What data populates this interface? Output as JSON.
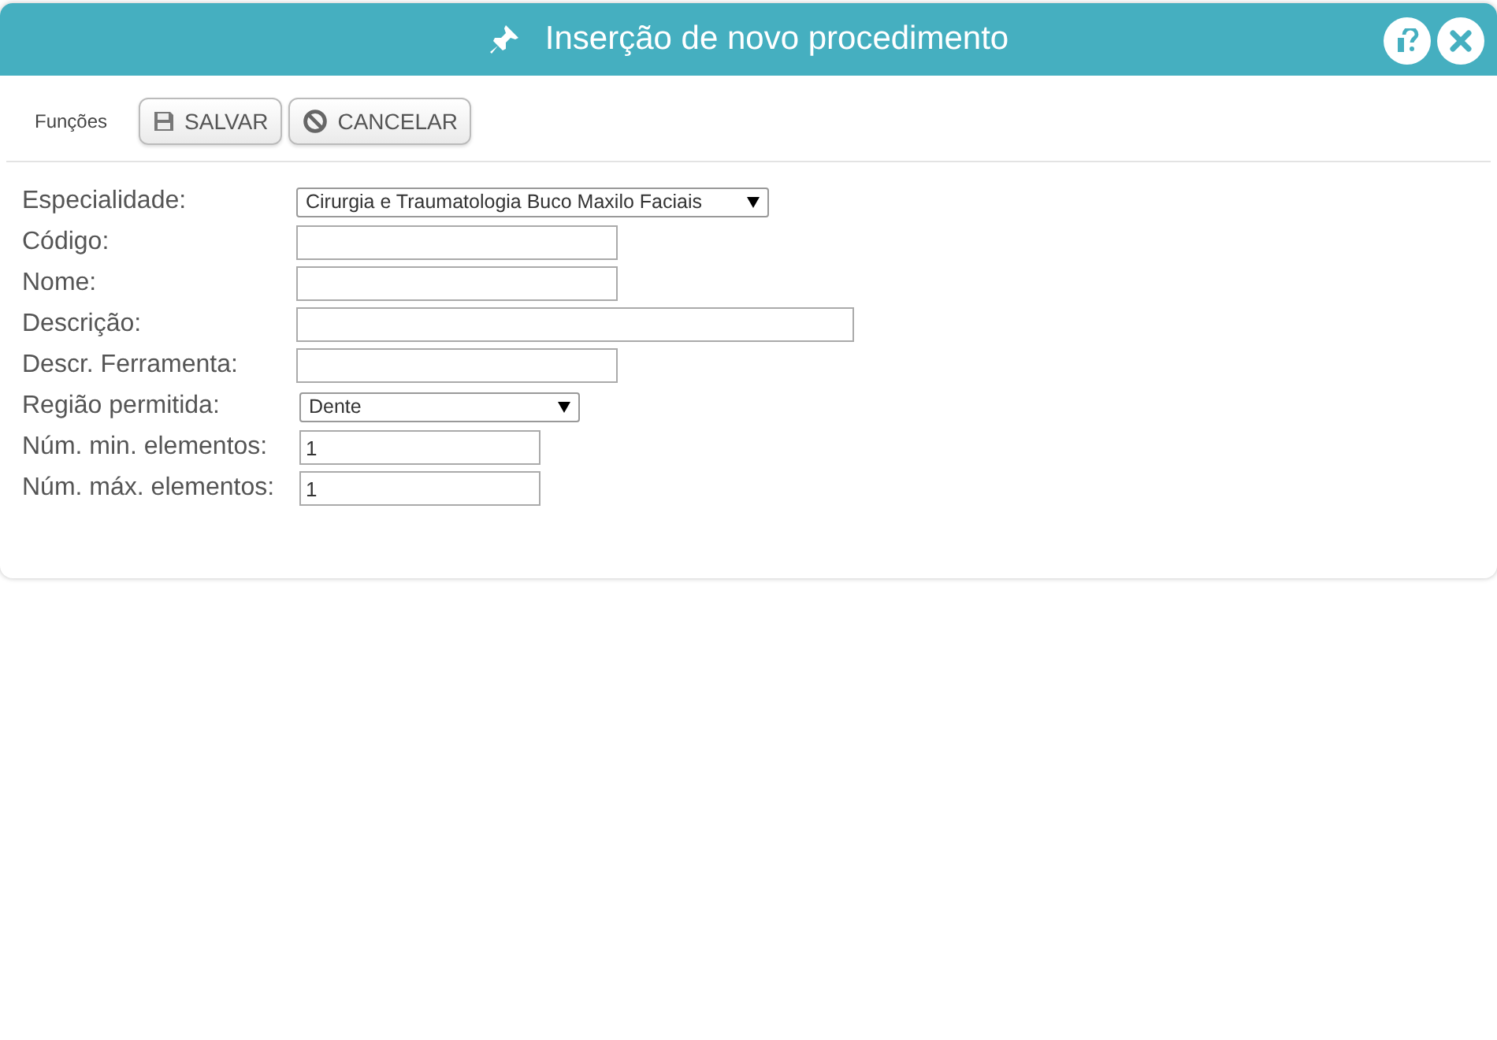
{
  "dialog": {
    "title": "Inserção de novo procedimento"
  },
  "toolbar": {
    "label": "Funções",
    "buttons": [
      {
        "kind": "save",
        "label": "SALVAR"
      },
      {
        "kind": "cancel",
        "label": "CANCELAR"
      }
    ]
  },
  "fields": [
    {
      "label": "Especialidade:",
      "kind": "select",
      "value": "Cirurgia e Traumatologia Buco Maxilo Faciais"
    },
    {
      "label": "Código:",
      "kind": "short"
    },
    {
      "label": "Nome:",
      "kind": "short"
    },
    {
      "label": "Descrição:",
      "kind": "long"
    },
    {
      "label": "Descr. Ferramenta:",
      "kind": "short"
    },
    {
      "label": "Região permitida:",
      "kind": "small-select",
      "value": "Dente"
    },
    {
      "label": "Núm. min. elementos:",
      "kind": "number",
      "value": "1"
    },
    {
      "label": "Núm. máx. elementos:",
      "kind": "number",
      "value": "1"
    }
  ]
}
